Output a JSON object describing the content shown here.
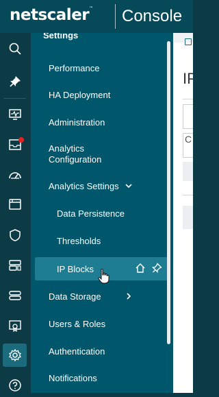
{
  "header": {
    "brand": "netscaler",
    "brand_mark": "™",
    "product": "Console"
  },
  "panel": {
    "title": "Settings",
    "items": [
      {
        "label": "Performance"
      },
      {
        "label": "HA Deployment"
      },
      {
        "label": "Administration"
      },
      {
        "label": "Analytics Configuration"
      },
      {
        "label": "Analytics Settings",
        "expanded": true
      },
      {
        "label": "Data Persistence"
      },
      {
        "label": "Thresholds"
      },
      {
        "label": "IP Blocks",
        "selected": true
      },
      {
        "label": "Data Storage",
        "has_submenu": true
      },
      {
        "label": "Users & Roles"
      },
      {
        "label": "Authentication"
      },
      {
        "label": "Notifications"
      }
    ]
  },
  "content": {
    "title_partial": "IP",
    "search_partial": "C"
  },
  "rail": {
    "icons": [
      "search-icon",
      "pin-icon",
      "monitor-icon",
      "inbox-icon",
      "gauge-icon",
      "window-icon",
      "shield-icon",
      "devices-icon",
      "server-icon",
      "certificate-icon",
      "gear-icon",
      "help-icon"
    ],
    "notification_color": "#e8201f"
  },
  "colors": {
    "header_bg": "#064a5a",
    "rail_bg": "#0d3b45",
    "panel_bg": "#00566b",
    "selected_bg": "#1e7d92"
  }
}
